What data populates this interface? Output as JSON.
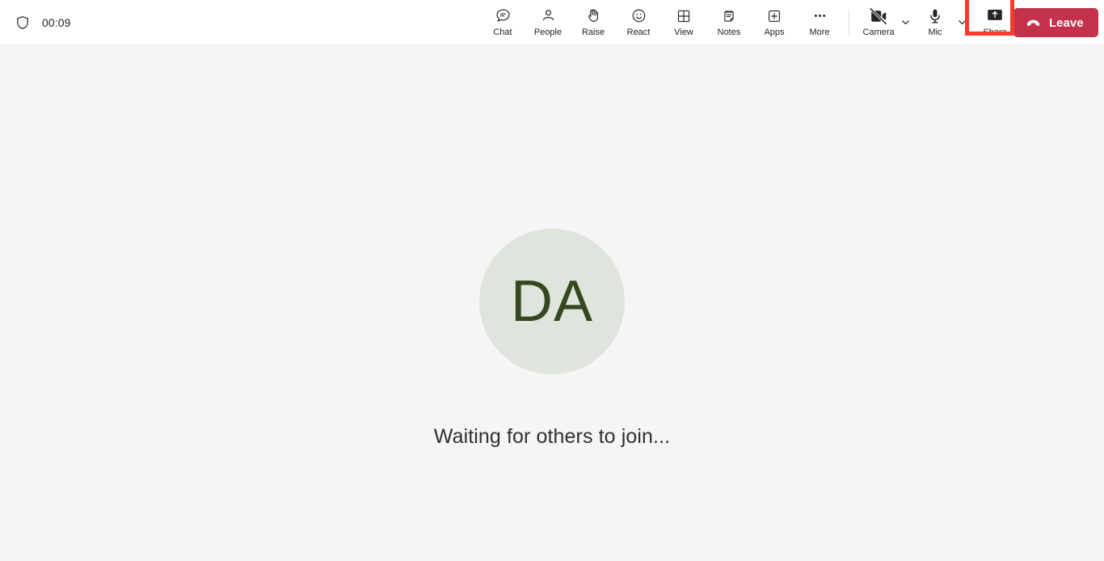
{
  "topbar": {
    "shield_icon": "shield-icon",
    "timer": "00:09",
    "controls": [
      {
        "key": "chat",
        "label": "Chat",
        "icon": "chat-icon"
      },
      {
        "key": "people",
        "label": "People",
        "icon": "people-icon"
      },
      {
        "key": "raise",
        "label": "Raise",
        "icon": "raise-hand-icon"
      },
      {
        "key": "react",
        "label": "React",
        "icon": "react-emoji-icon"
      },
      {
        "key": "view",
        "label": "View",
        "icon": "view-grid-icon"
      },
      {
        "key": "notes",
        "label": "Notes",
        "icon": "notes-icon"
      },
      {
        "key": "apps",
        "label": "Apps",
        "icon": "apps-plus-icon"
      },
      {
        "key": "more",
        "label": "More",
        "icon": "more-ellipsis-icon"
      }
    ],
    "camera": {
      "label": "Camera",
      "icon": "camera-off-icon",
      "chevron": "chevron-down-icon"
    },
    "mic": {
      "label": "Mic",
      "icon": "microphone-icon",
      "chevron": "chevron-down-icon"
    },
    "share": {
      "label": "Share",
      "icon": "share-screen-icon",
      "highlighted": true
    },
    "leave": {
      "label": "Leave",
      "icon": "hangup-phone-icon"
    }
  },
  "stage": {
    "avatar_initials": "DA",
    "waiting_message": "Waiting for others to join..."
  },
  "colors": {
    "topbar_background": "#ffffff",
    "stage_background": "#f5f5f5",
    "text_primary": "#242424",
    "leave_red": "#c4314b",
    "highlight_red": "#fd3b28",
    "avatar_background": "#dfe4dc",
    "avatar_text": "#35471f"
  }
}
